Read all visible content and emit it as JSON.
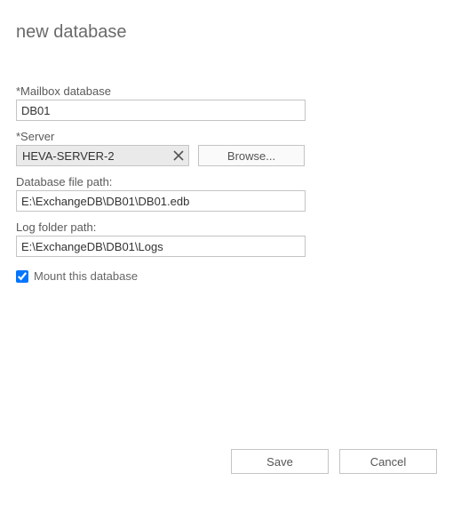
{
  "title": "new database",
  "fields": {
    "mailbox_label": "*Mailbox database",
    "mailbox_value": "DB01",
    "server_label": "*Server",
    "server_value": "HEVA-SERVER-2",
    "browse_label": "Browse...",
    "dbfile_label": "Database file path:",
    "dbfile_value": "E:\\ExchangeDB\\DB01\\DB01.edb",
    "log_label": "Log folder path:",
    "log_value": "E:\\ExchangeDB\\DB01\\Logs",
    "mount_label": "Mount this database",
    "mount_checked": true
  },
  "footer": {
    "save_label": "Save",
    "cancel_label": "Cancel"
  }
}
